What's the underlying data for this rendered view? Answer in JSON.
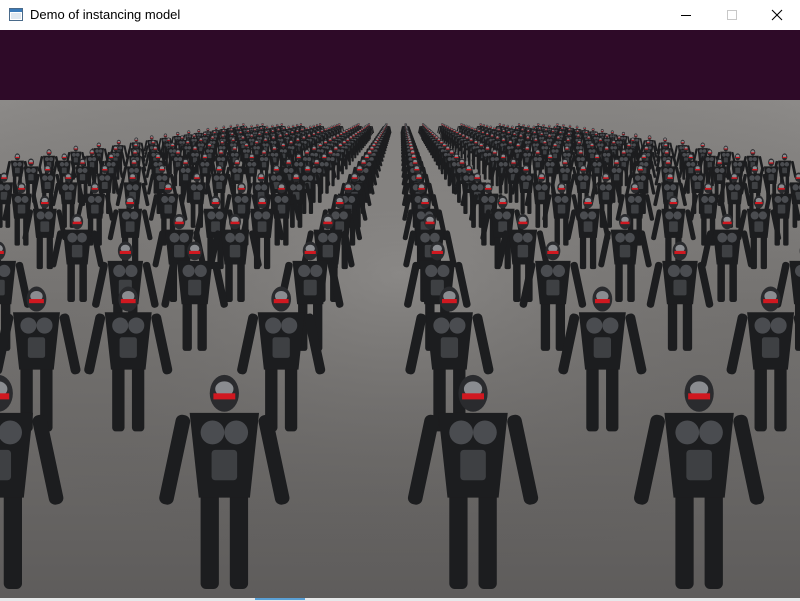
{
  "window": {
    "title": "Demo of instancing model",
    "icon": "app-window-icon"
  },
  "caption_buttons": {
    "minimize_icon": "minimize-icon",
    "maximize_icon": "maximize-icon",
    "close_icon": "close-icon"
  },
  "scene": {
    "sky_color": "#2e0a28",
    "floor_color": "#6e6c6b",
    "floor_far_color": "#8a8886",
    "soldier_body_color": "#1c1d1f",
    "soldier_armor_color": "#4a4c50",
    "soldier_visor_color": "#d01820",
    "groups": 4
  }
}
